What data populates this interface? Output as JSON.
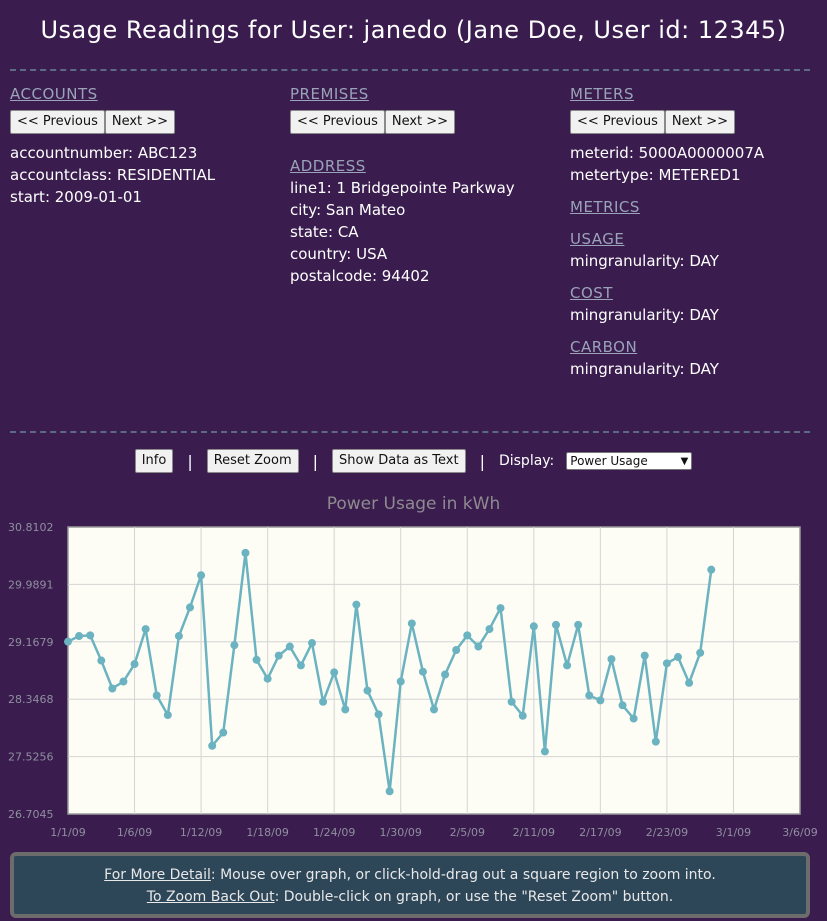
{
  "page_title": "Usage Readings for User: janedo (Jane Doe, User id: 12345)",
  "accounts": {
    "heading": "ACCOUNTS",
    "prev_label": "<< Previous",
    "next_label": "Next >>",
    "fields": [
      {
        "key": "accountnumber",
        "value": "ABC123"
      },
      {
        "key": "accountclass",
        "value": "RESIDENTIAL"
      },
      {
        "key": "start",
        "value": "2009-01-01"
      }
    ]
  },
  "premises": {
    "heading": "PREMISES",
    "prev_label": "<< Previous",
    "next_label": "Next >>",
    "address_heading": "ADDRESS",
    "fields": [
      {
        "key": "line1",
        "value": "1 Bridgepointe Parkway"
      },
      {
        "key": "city",
        "value": "San Mateo"
      },
      {
        "key": "state",
        "value": "CA"
      },
      {
        "key": "country",
        "value": "USA"
      },
      {
        "key": "postalcode",
        "value": "94402"
      }
    ]
  },
  "meters": {
    "heading": "METERS",
    "prev_label": "<< Previous",
    "next_label": "Next >>",
    "fields": [
      {
        "key": "meterid",
        "value": "5000A0000007A"
      },
      {
        "key": "metertype",
        "value": "METERED1"
      }
    ],
    "metrics_heading": "METRICS",
    "metrics": [
      {
        "name": "USAGE",
        "key": "mingranularity",
        "value": "DAY"
      },
      {
        "name": "COST",
        "key": "mingranularity",
        "value": "DAY"
      },
      {
        "name": "CARBON",
        "key": "mingranularity",
        "value": "DAY"
      }
    ]
  },
  "toolbar": {
    "info_label": "Info",
    "reset_zoom_label": "Reset Zoom",
    "show_text_label": "Show Data as Text",
    "separator": "|",
    "display_label": "Display:",
    "display_selected": "Power Usage"
  },
  "help": {
    "line1_link": "For More Detail",
    "line1_text": ":  Mouse over graph, or click-hold-drag out a square region to zoom into.",
    "line2_link": "To Zoom Back Out",
    "line2_text": ":  Double-click on graph, or use the \"Reset Zoom\" button."
  },
  "colors": {
    "background": "#3a1d4e",
    "line": "#6bb3c0",
    "plot_bg": "#fdfdf5",
    "help_bg": "#2d4658"
  },
  "chart_data": {
    "type": "line",
    "title": "Power Usage in kWh",
    "xlabel": "",
    "ylabel": "",
    "x_tick_labels": [
      "1/1/09",
      "1/6/09",
      "1/12/09",
      "1/18/09",
      "1/24/09",
      "1/30/09",
      "2/5/09",
      "2/11/09",
      "2/17/09",
      "2/23/09",
      "3/1/09",
      "3/6/09"
    ],
    "y_tick_labels": [
      "30.8102",
      "29.9891",
      "29.1679",
      "28.3468",
      "27.5256",
      "26.7045"
    ],
    "ylim": [
      26.7045,
      30.8102
    ],
    "xlim_days": [
      0,
      66
    ],
    "grid": true,
    "series": [
      {
        "values": [
          29.17,
          29.25,
          29.26,
          28.9,
          28.5,
          28.6,
          28.85,
          29.35,
          28.4,
          28.12,
          29.25,
          29.66,
          30.12,
          27.68,
          27.87,
          29.12,
          30.44,
          28.91,
          28.64,
          28.97,
          29.1,
          28.83,
          29.15,
          28.31,
          28.73,
          28.2,
          29.7,
          28.47,
          28.13,
          27.03,
          28.6,
          29.43,
          28.74,
          28.2,
          28.7,
          29.05,
          29.26,
          29.1,
          29.35,
          29.65,
          28.31,
          28.11,
          29.39,
          27.6,
          29.41,
          28.83,
          29.41,
          28.4,
          28.33,
          28.92,
          28.26,
          28.07,
          28.97,
          27.74,
          28.86,
          28.95,
          28.58,
          29.01,
          30.2
        ]
      }
    ]
  }
}
